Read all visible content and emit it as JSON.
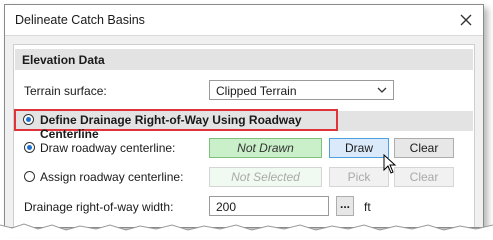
{
  "dialog": {
    "title": "Delineate Catch Basins"
  },
  "elevation_section": {
    "header": "Elevation Data",
    "terrain_label": "Terrain surface:",
    "terrain_value": "Clipped Terrain"
  },
  "drainage_section": {
    "header": "Define Drainage Right-of-Way Using Roadway Centerline",
    "draw_option_label": "Draw roadway centerline:",
    "draw_status": "Not Drawn",
    "draw_button": "Draw",
    "clear_button": "Clear",
    "assign_option_label": "Assign roadway centerline:",
    "assign_status": "Not Selected",
    "pick_button": "Pick",
    "clear_button_2": "Clear",
    "width_label": "Drainage right-of-way width:",
    "width_value": "200",
    "browse_button": "...",
    "width_unit": "ft"
  },
  "colors": {
    "highlight_border": "#e0343a",
    "status_green": "#c9f0c9",
    "draw_button_blue": "#dbeafa"
  }
}
